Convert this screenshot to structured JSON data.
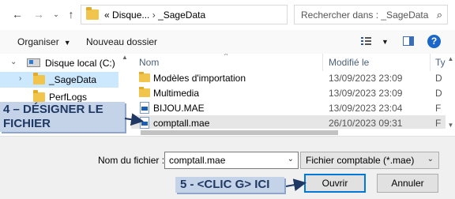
{
  "address": {
    "prefix": "«",
    "path_parts": [
      "Disque...",
      "_SageData"
    ],
    "separator": "›",
    "search_placeholder": "Rechercher dans : _SageData"
  },
  "toolbar": {
    "organize_label": "Organiser",
    "new_folder_label": "Nouveau dossier"
  },
  "nav": {
    "items": [
      {
        "label": "Disque local (C:)",
        "expanded": true
      },
      {
        "label": "_SageData",
        "selected": true
      },
      {
        "label": "PerfLogs"
      }
    ]
  },
  "files": {
    "columns": [
      "Nom",
      "Modifié le",
      "Ty"
    ],
    "rows": [
      {
        "name": "Modèles d'importation",
        "date": "13/09/2023 23:09",
        "type": "D",
        "icon": "folder-icon"
      },
      {
        "name": "Multimedia",
        "date": "13/09/2023 23:09",
        "type": "D",
        "icon": "folder-icon"
      },
      {
        "name": "BIJOU.MAE",
        "date": "13/09/2023 23:04",
        "type": "F",
        "icon": "sage-file-icon"
      },
      {
        "name": "comptall.mae",
        "date": "26/10/2023 09:31",
        "type": "F",
        "icon": "sage-file-icon",
        "selected": true
      }
    ]
  },
  "bottom": {
    "filename_label": "Nom du fichier :",
    "filename_value": "comptall.mae",
    "filetype_value": "Fichier comptable (*.mae)",
    "open_label": "Ouvrir",
    "cancel_label": "Annuler"
  },
  "annotations": {
    "step4_line1": "4 – DÉSIGNER LE",
    "step4_line2": "FICHIER",
    "step5": "5 - <CLIC G> ICI"
  },
  "colors": {
    "selection": "#cce8ff",
    "primary_border": "#0078d7",
    "callout_bg": "#c5d3e8",
    "callout_text": "#1f3864"
  }
}
